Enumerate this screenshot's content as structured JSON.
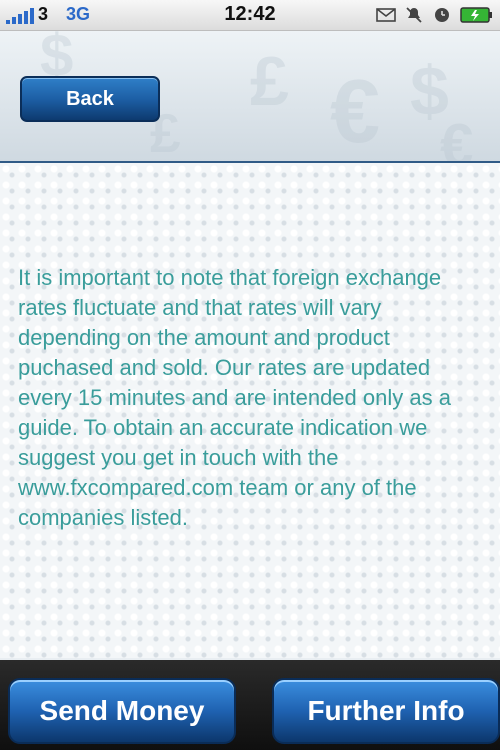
{
  "status_bar": {
    "carrier": "3",
    "network": "3G",
    "time": "12:42",
    "icons": [
      "mail-icon",
      "silent-icon",
      "alarm-icon",
      "battery-charging-icon"
    ]
  },
  "header": {
    "back_label": "Back",
    "background_symbols": [
      "$",
      "£",
      "€",
      "$",
      "£",
      "€"
    ]
  },
  "content": {
    "note": "It is important to note that foreign exchange rates fluctuate and that rates will vary depending on the amount and product puchased and sold. Our rates are updated every 15 minutes and are intended only as a guide. To obtain an accurate indication we suggest you get in touch with the www.fxcompared.com team or any of the companies listed."
  },
  "bottom_bar": {
    "send_money_label": "Send Money",
    "further_info_label": "Further Info"
  },
  "colors": {
    "accent_blue": "#1d5fa5",
    "text_teal": "#3a9d9b"
  }
}
